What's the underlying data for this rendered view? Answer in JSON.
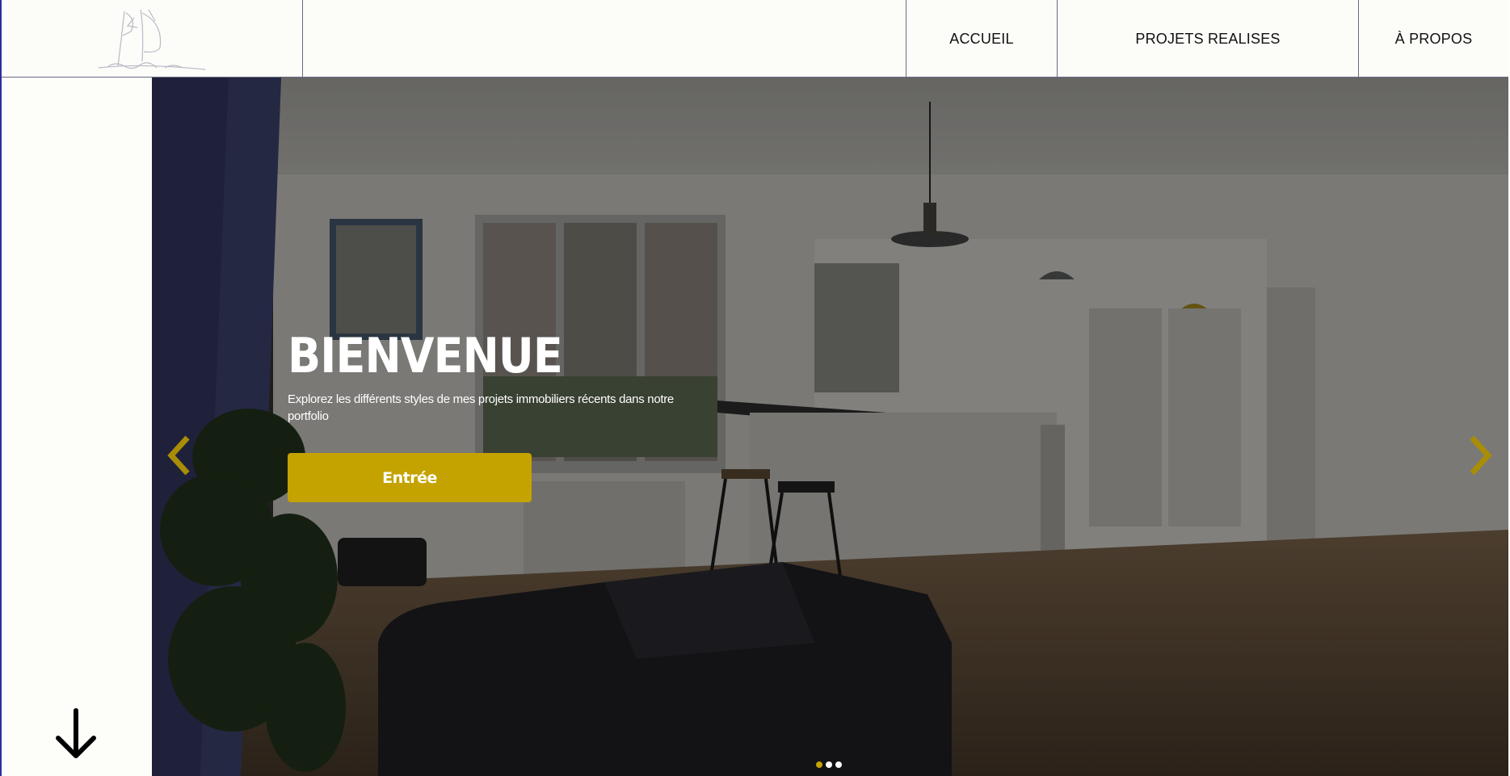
{
  "header": {
    "logo_icon": "sailboat-sketch-logo",
    "nav": [
      {
        "label": "ACCUEIL"
      },
      {
        "label": "PROJETS REALISES"
      },
      {
        "label": "À PROPOS"
      }
    ]
  },
  "hero": {
    "title": "BIENVENUE",
    "subtitle": "Explorez les différents styles de mes projets immobiliers récents dans notre portfolio",
    "cta_label": "Entrée",
    "prev_icon": "chevron-left-icon",
    "next_icon": "chevron-right-icon",
    "slides_count": 3,
    "active_slide": 1
  },
  "side": {
    "scroll_icon": "arrow-down-icon"
  },
  "colors": {
    "accent": "#c4a300",
    "header_bg": "#fcfcf8",
    "border": "#2a2f9e"
  }
}
